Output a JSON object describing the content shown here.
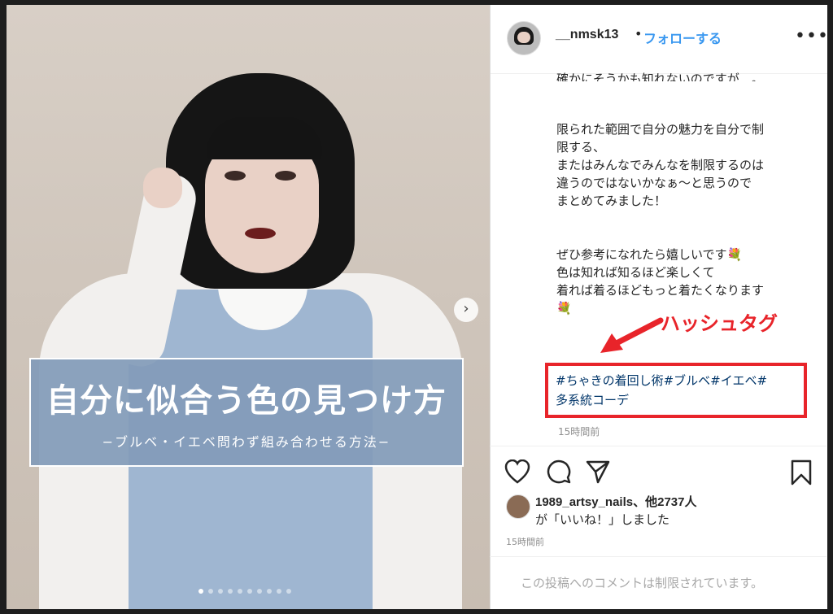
{
  "post": {
    "username": "__nmsk13",
    "separator": "•",
    "follow_label": "フォローする",
    "more_label": "•••"
  },
  "image": {
    "banner_title": "自分に似合う色の見つけ方",
    "banner_subtitle": "−ブルベ・イエベ問わず組み合わせる方法−",
    "next_label": "›",
    "dots": 10,
    "active_dot": 0
  },
  "caption": {
    "cut_line": "確かにそうかも知れないのですが…。",
    "para1": [
      "限られた範囲で自分の魅力を自分で制",
      "限する、",
      "またはみんなでみんなを制限するのは",
      "違うのではないかなぁ〜と思うので",
      "まとめてみました！"
    ],
    "para2": [
      "ぜひ参考になれたら嬉しいです💐",
      "色は知れば知るほど楽しくて",
      "着れば着るほどもっと着たくなります",
      "💐"
    ],
    "hashtags_line1": "#ちゃきの着回し術#ブルベ#イエベ#",
    "hashtags_line2": "多系統コーデ",
    "time": "15時間前"
  },
  "annotation": {
    "label": "ハッシュタグ",
    "color": "#e8242a"
  },
  "engagement": {
    "likes_line1": "1989_artsy_nails、他2737人",
    "likes_line2": "が「いいね！」しました",
    "time": "15時間前"
  },
  "comments": {
    "disabled_text": "この投稿へのコメントは制限されています。"
  },
  "colors": {
    "follow": "#3897f0",
    "hashtag": "#003569",
    "timestamp": "#8e8e8e"
  }
}
